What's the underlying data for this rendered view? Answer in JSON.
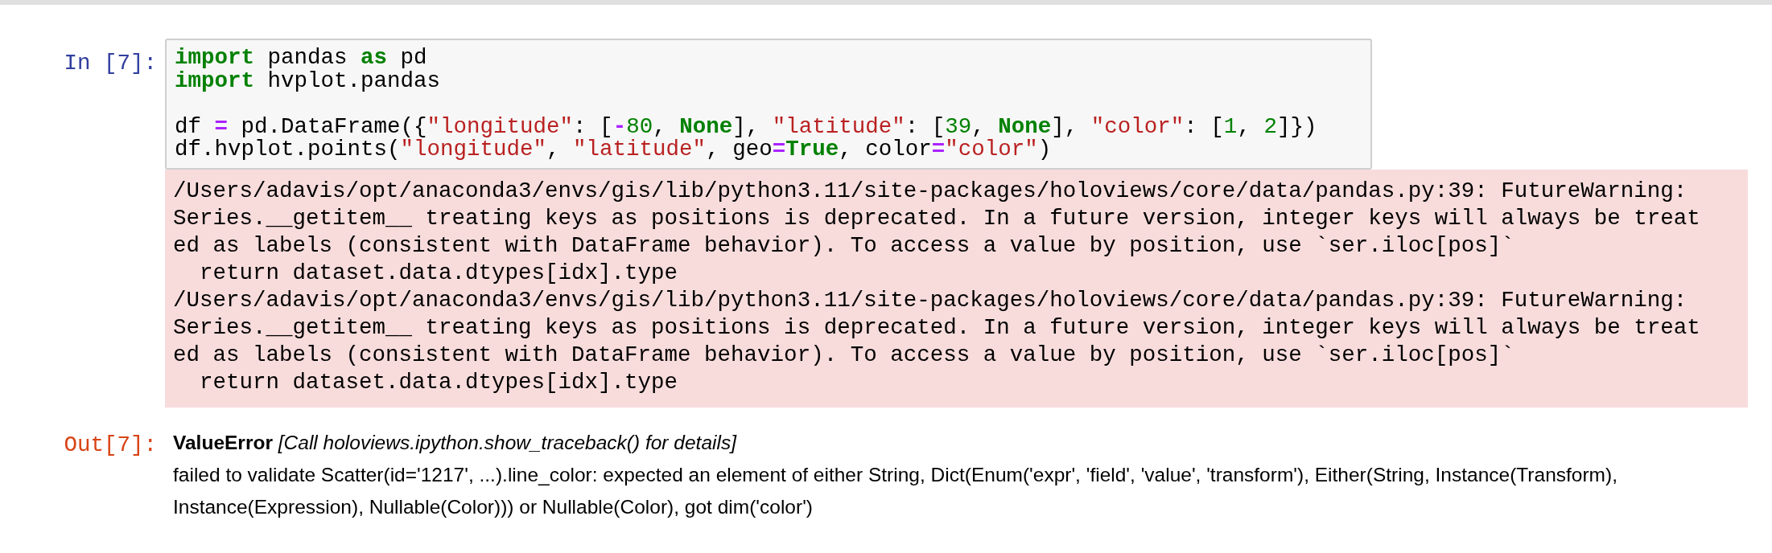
{
  "input_cell": {
    "prompt": "In [7]:",
    "code": [
      {
        "text": "import",
        "kind": "keyword"
      },
      {
        "text": " pandas ",
        "kind": "plain"
      },
      {
        "text": "as",
        "kind": "keyword"
      },
      {
        "text": " pd\n",
        "kind": "plain"
      },
      {
        "text": "import",
        "kind": "keyword"
      },
      {
        "text": " hvplot.pandas\n\ndf ",
        "kind": "plain"
      },
      {
        "text": "=",
        "kind": "operator"
      },
      {
        "text": " pd.DataFrame({",
        "kind": "plain"
      },
      {
        "text": "\"longitude\"",
        "kind": "string"
      },
      {
        "text": ": [",
        "kind": "plain"
      },
      {
        "text": "-",
        "kind": "operator"
      },
      {
        "text": "80",
        "kind": "number"
      },
      {
        "text": ", ",
        "kind": "plain"
      },
      {
        "text": "None",
        "kind": "keyword"
      },
      {
        "text": "], ",
        "kind": "plain"
      },
      {
        "text": "\"latitude\"",
        "kind": "string"
      },
      {
        "text": ": [",
        "kind": "plain"
      },
      {
        "text": "39",
        "kind": "number"
      },
      {
        "text": ", ",
        "kind": "plain"
      },
      {
        "text": "None",
        "kind": "keyword"
      },
      {
        "text": "], ",
        "kind": "plain"
      },
      {
        "text": "\"color\"",
        "kind": "string"
      },
      {
        "text": ": [",
        "kind": "plain"
      },
      {
        "text": "1",
        "kind": "number"
      },
      {
        "text": ", ",
        "kind": "plain"
      },
      {
        "text": "2",
        "kind": "number"
      },
      {
        "text": "]})\ndf.hvplot.points(",
        "kind": "plain"
      },
      {
        "text": "\"longitude\"",
        "kind": "string"
      },
      {
        "text": ", ",
        "kind": "plain"
      },
      {
        "text": "\"latitude\"",
        "kind": "string"
      },
      {
        "text": ", geo",
        "kind": "plain"
      },
      {
        "text": "=",
        "kind": "operator"
      },
      {
        "text": "True",
        "kind": "keyword"
      },
      {
        "text": ", color",
        "kind": "plain"
      },
      {
        "text": "=",
        "kind": "operator"
      },
      {
        "text": "\"color\"",
        "kind": "string"
      },
      {
        "text": ")",
        "kind": "plain"
      }
    ]
  },
  "stderr": [
    "/Users/adavis/opt/anaconda3/envs/gis/lib/python3.11/site-packages/holoviews/core/data/pandas.py:39: FutureWarning:",
    "Series.__getitem__ treating keys as positions is deprecated. In a future version, integer keys will always be treat",
    "ed as labels (consistent with DataFrame behavior). To access a value by position, use `ser.iloc[pos]`",
    "  return dataset.data.dtypes[idx].type",
    "/Users/adavis/opt/anaconda3/envs/gis/lib/python3.11/site-packages/holoviews/core/data/pandas.py:39: FutureWarning:",
    "Series.__getitem__ treating keys as positions is deprecated. In a future version, integer keys will always be treat",
    "ed as labels (consistent with DataFrame behavior). To access a value by position, use `ser.iloc[pos]`",
    "  return dataset.data.dtypes[idx].type"
  ],
  "output": {
    "prompt": "Out[7]:",
    "heading": "**ValueError** *[Call holoviews.ipython.show_traceback() for details]*",
    "message": "failed to validate Scatter(id='1217', ...).line_color: expected an element of either String, Dict(Enum('expr', 'field', 'value', 'transform'), Either(String, Instance(Transform), Instance(Expression), Nullable(Color))) or Nullable(Color), got dim('color')"
  }
}
